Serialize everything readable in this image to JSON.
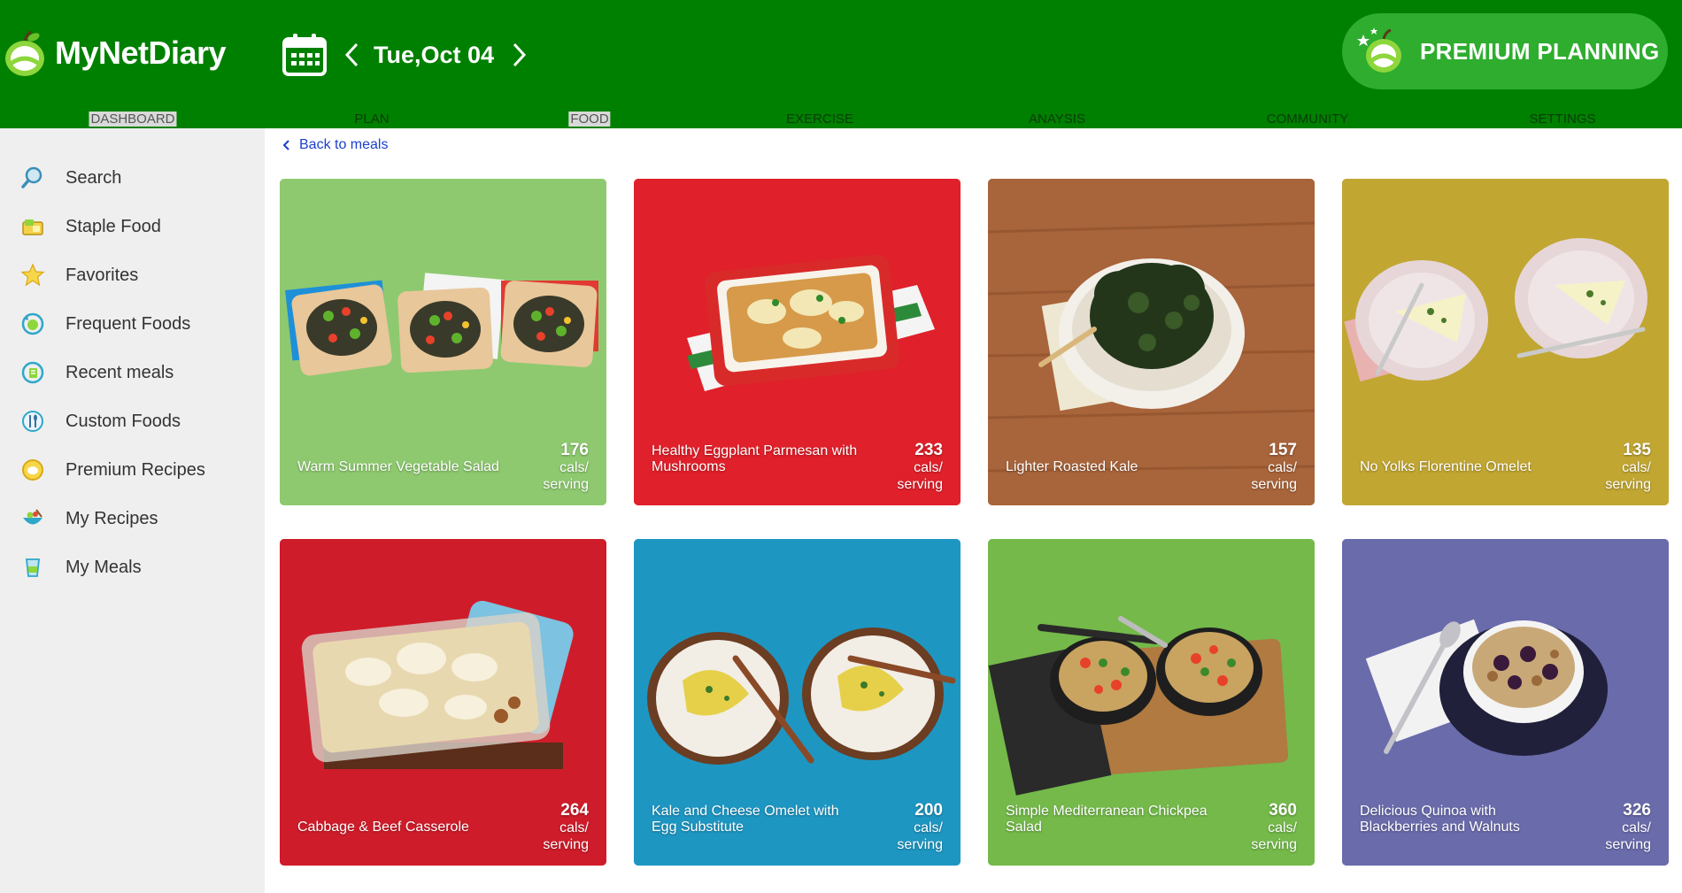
{
  "app": {
    "logo_text": "MyNetDiary"
  },
  "datebar": {
    "date": "Tue,Oct 04"
  },
  "premium": {
    "label": "PREMIUM PLANNING"
  },
  "nav": {
    "items": [
      {
        "label": "DASHBOARD",
        "active": true
      },
      {
        "label": "PLAN",
        "active": false
      },
      {
        "label": "FOOD",
        "active": true
      },
      {
        "label": "EXERCISE",
        "active": false
      },
      {
        "label": "ANAYSIS",
        "active": false
      },
      {
        "label": "COMMUNITY",
        "active": false
      },
      {
        "label": "SETTINGS",
        "active": false
      }
    ]
  },
  "sidebar": {
    "items": [
      {
        "label": "Search",
        "icon": "search-icon"
      },
      {
        "label": "Staple Food",
        "icon": "staple-food-icon"
      },
      {
        "label": "Favorites",
        "icon": "star-icon"
      },
      {
        "label": "Frequent Foods",
        "icon": "frequent-foods-icon"
      },
      {
        "label": "Recent meals",
        "icon": "recent-meals-icon"
      },
      {
        "label": "Custom Foods",
        "icon": "custom-foods-icon"
      },
      {
        "label": "Premium Recipes",
        "icon": "premium-recipes-icon"
      },
      {
        "label": "My Recipes",
        "icon": "my-recipes-icon"
      },
      {
        "label": "My Meals",
        "icon": "my-meals-icon"
      }
    ]
  },
  "main": {
    "back_label": "Back to meals",
    "recipes": [
      {
        "name": "Warm Summer Vegetable Salad",
        "cals": "176",
        "unit_line1": "cals/",
        "unit_line2": "serving",
        "bg": "#8ec96f"
      },
      {
        "name": "Healthy Eggplant Parmesan with Mushrooms",
        "cals": "233",
        "unit_line1": "cals/",
        "unit_line2": "serving",
        "bg": "#e0202a"
      },
      {
        "name": "Lighter Roasted Kale",
        "cals": "157",
        "unit_line1": "cals/",
        "unit_line2": "serving",
        "bg": "#a8643a"
      },
      {
        "name": "No Yolks Florentine Omelet",
        "cals": "135",
        "unit_line1": "cals/",
        "unit_line2": "serving",
        "bg": "#c1a632"
      },
      {
        "name": "Cabbage & Beef Casserole",
        "cals": "264",
        "unit_line1": "cals/",
        "unit_line2": "serving",
        "bg": "#cf1c2a"
      },
      {
        "name": "Kale and Cheese Omelet with Egg Substitute",
        "cals": "200",
        "unit_line1": "cals/",
        "unit_line2": "serving",
        "bg": "#1e96c2"
      },
      {
        "name": "Simple Mediterranean Chickpea Salad",
        "cals": "360",
        "unit_line1": "cals/",
        "unit_line2": "serving",
        "bg": "#74b94a"
      },
      {
        "name": "Delicious Quinoa with Blackberries and Walnuts",
        "cals": "326",
        "unit_line1": "cals/",
        "unit_line2": "serving",
        "bg": "#6a6bab"
      }
    ]
  },
  "colors": {
    "header": "#008000",
    "premium_button": "#2ead2e",
    "sidebar": "#efefef",
    "link": "#1a3fcc"
  }
}
